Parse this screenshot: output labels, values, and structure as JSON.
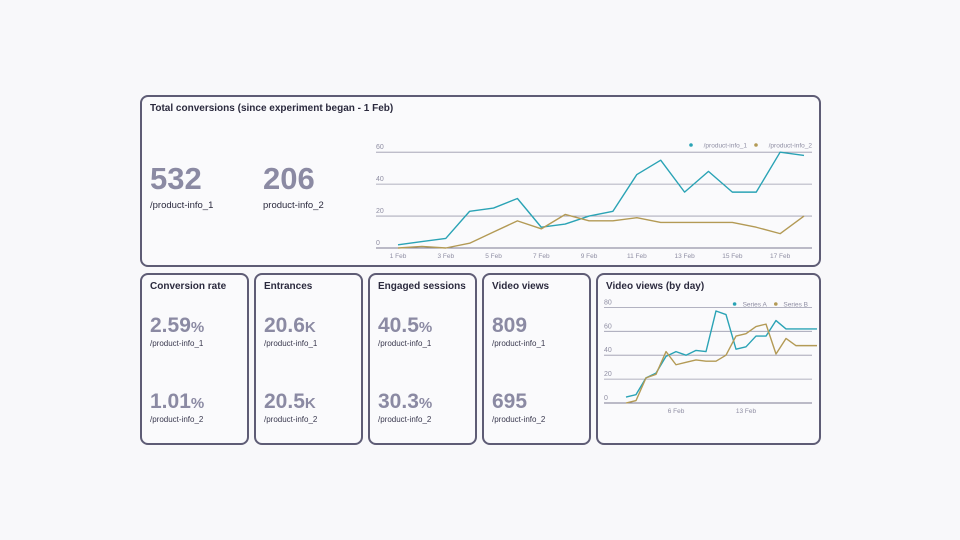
{
  "total": {
    "title": "Total conversions (since experiment began - 1 Feb)",
    "stat1": {
      "value": "532",
      "label": "/product-info_1"
    },
    "stat2": {
      "value": "206",
      "label": "product-info_2"
    }
  },
  "metrics": [
    {
      "title": "Conversion rate",
      "v1": "2.59",
      "s1": "%",
      "l1": "/product-info_1",
      "v2": "1.01",
      "s2": "%",
      "l2": "/product-info_2"
    },
    {
      "title": "Entrances",
      "v1": "20.6",
      "s1": "K",
      "l1": "/product-info_1",
      "v2": "20.5",
      "s2": "K",
      "l2": "/product-info_2"
    },
    {
      "title": "Engaged sessions",
      "v1": "40.5",
      "s1": "%",
      "l1": "/product-info_1",
      "v2": "30.3",
      "s2": "%",
      "l2": "/product-info_2"
    },
    {
      "title": "Video views",
      "v1": "809",
      "s1": "",
      "l1": "/product-info_1",
      "v2": "695",
      "s2": "",
      "l2": "/product-info_2"
    }
  ],
  "daily": {
    "title": "Video views (by day)"
  },
  "colors": {
    "series1": "#2aa3b5",
    "series2": "#b39a55",
    "border": "#5e5c75",
    "value": "#8b8aa3"
  },
  "chart_data": [
    {
      "type": "line",
      "x": [
        "1 Feb",
        "2 Feb",
        "3 Feb",
        "4 Feb",
        "5 Feb",
        "6 Feb",
        "7 Feb",
        "8 Feb",
        "9 Feb",
        "10 Feb",
        "11 Feb",
        "12 Feb",
        "13 Feb",
        "14 Feb",
        "15 Feb",
        "16 Feb",
        "17 Feb",
        "18 Feb"
      ],
      "xticks": [
        "1 Feb",
        "3 Feb",
        "5 Feb",
        "7 Feb",
        "9 Feb",
        "11 Feb",
        "13 Feb",
        "15 Feb",
        "17 Feb"
      ],
      "yticks": [
        0,
        20,
        40,
        60
      ],
      "ylim": [
        0,
        62
      ],
      "series": [
        {
          "name": "/product-info_1",
          "values": [
            2,
            4,
            6,
            23,
            25,
            31,
            13,
            15,
            20,
            23,
            46,
            55,
            35,
            48,
            35,
            35,
            60,
            58
          ]
        },
        {
          "name": "/product-info_2",
          "values": [
            0,
            1,
            0,
            3,
            10,
            17,
            12,
            21,
            17,
            17,
            19,
            16,
            16,
            16,
            16,
            13,
            9,
            20
          ]
        }
      ],
      "legend": "top-right",
      "grid": true
    },
    {
      "type": "line",
      "x": [
        1,
        2,
        3,
        4,
        5,
        6,
        7,
        8,
        9,
        10,
        11,
        12,
        13,
        14,
        15,
        16,
        17,
        18,
        19,
        20,
        21
      ],
      "xticks": [
        {
          "x": 6,
          "label": "6 Feb"
        },
        {
          "x": 13,
          "label": "13 Feb"
        }
      ],
      "yticks": [
        0,
        20,
        40,
        60,
        80
      ],
      "ylim": [
        0,
        82
      ],
      "series": [
        {
          "name": "Series A",
          "values": [
            5,
            7,
            21,
            25,
            39,
            43,
            40,
            44,
            43,
            77,
            74,
            45,
            47,
            56,
            56,
            69,
            62,
            62,
            62,
            62,
            62
          ]
        },
        {
          "name": "Series B",
          "values": [
            0,
            2,
            21,
            24,
            43,
            32,
            34,
            36,
            35,
            35,
            40,
            56,
            58,
            64,
            66,
            41,
            54,
            48,
            48,
            48,
            48
          ]
        }
      ],
      "legend": "top-right",
      "grid": true
    }
  ]
}
